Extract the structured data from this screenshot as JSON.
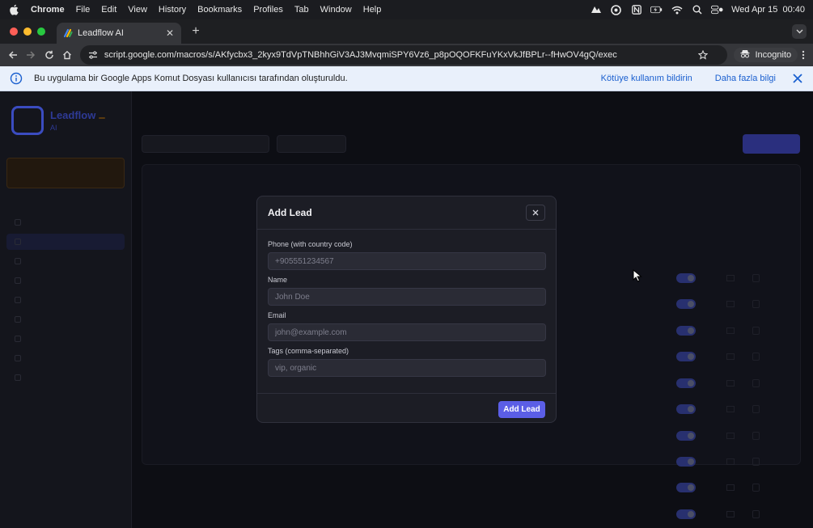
{
  "menubar": {
    "app": "Chrome",
    "menus": [
      "File",
      "Edit",
      "View",
      "History",
      "Bookmarks",
      "Profiles",
      "Tab",
      "Window",
      "Help"
    ],
    "datetime": "Wed Apr 15  00:40"
  },
  "browser": {
    "tab_title": "Leadflow AI",
    "url": "script.google.com/macros/s/AKfycbx3_2kyx9TdVpTNBhhGiV3AJ3MvqmiSPY6Vz6_p8pOQOFKFuYKxVkJfBPLr--fHwOV4gQ/exec",
    "profile_label": "Incognito"
  },
  "infobar": {
    "message": "Bu uygulama bir Google Apps Komut Dosyası kullanıcısı tarafından oluşturuldu.",
    "report_link": "Kötüye kullanım bildirin",
    "more_link": "Daha fazla bilgi"
  },
  "modal": {
    "title": "Add Lead",
    "fields": [
      {
        "label": "Phone (with country code)",
        "placeholder": "+905551234567",
        "value": ""
      },
      {
        "label": "Name",
        "placeholder": "John Doe",
        "value": ""
      },
      {
        "label": "Email",
        "placeholder": "john@example.com",
        "value": ""
      },
      {
        "label": "Tags (comma-separated)",
        "placeholder": "vip, organic",
        "value": ""
      }
    ],
    "submit_label": "Add Lead"
  },
  "colors": {
    "accent": "#5b5ee6",
    "modal_bg": "#1c1d25",
    "page_bg": "#0d0e14",
    "infobar_bg": "#e9f0fb",
    "link": "#1a5fcf"
  }
}
